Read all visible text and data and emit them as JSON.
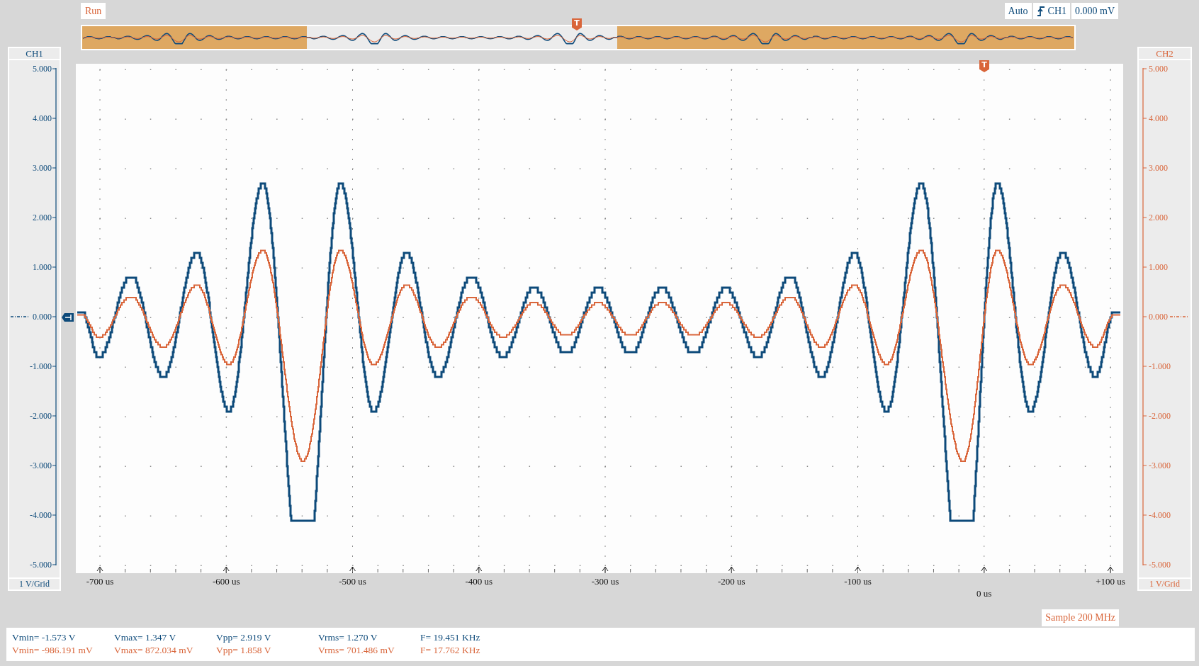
{
  "status": {
    "label": "Run"
  },
  "trigger": {
    "mode": "Auto",
    "source": "CH1",
    "level": "0.000 mV"
  },
  "overview": {
    "trigger_marker": "T"
  },
  "channels": [
    {
      "name": "CH1",
      "color": "#0d4a7a",
      "scale": "1 V/Grid",
      "ticks": [
        "5.000",
        "4.000",
        "3.000",
        "2.000",
        "1.000",
        "0.000",
        "-1.000",
        "-2.000",
        "-3.000",
        "-4.000",
        "-5.000"
      ]
    },
    {
      "name": "CH2",
      "color": "#d9653a",
      "scale": "1 V/Grid",
      "ticks": [
        "5.000",
        "4.000",
        "3.000",
        "2.000",
        "1.000",
        "0.000",
        "-1.000",
        "-2.000",
        "-3.000",
        "-4.000",
        "-5.000"
      ]
    }
  ],
  "plot": {
    "trigger_marker": "T",
    "x_labels": [
      {
        "text": "-700 us",
        "kind": "tick"
      },
      {
        "text": "-600 us",
        "kind": "tick"
      },
      {
        "text": "-500 us",
        "kind": "tick"
      },
      {
        "text": "-400 us",
        "kind": "tick"
      },
      {
        "text": "-300 us",
        "kind": "tick"
      },
      {
        "text": "-200 us",
        "kind": "tick"
      },
      {
        "text": "-100 us",
        "kind": "tick"
      },
      {
        "text": "0 us",
        "kind": "trigger"
      },
      {
        "text": "+100 us",
        "kind": "tick"
      }
    ]
  },
  "sample_rate": "Sample 200 MHz",
  "measurements": [
    {
      "values": [
        "Vmin= -1.573 V",
        "Vmax= 1.347 V",
        "Vpp= 2.919 V",
        "Vrms= 1.270 V",
        "F= 19.451 KHz"
      ]
    },
    {
      "values": [
        "Vmin= -986.191 mV",
        "Vmax= 872.034 mV",
        "Vpp= 1.858 V",
        "Vrms= 701.486 mV",
        "F= 17.762 KHz"
      ]
    }
  ]
}
